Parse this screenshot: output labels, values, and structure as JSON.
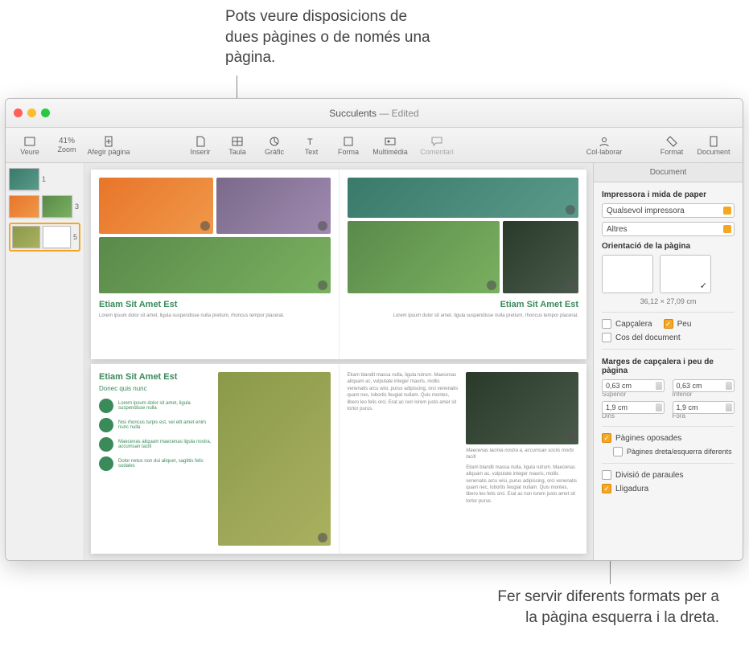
{
  "callouts": {
    "top": "Pots veure disposicions de dues pàgines o de només una pàgina.",
    "bottom": "Fer servir diferents formats per a la pàgina esquerra i la dreta."
  },
  "window": {
    "title_doc": "Succulents",
    "title_state": "Edited"
  },
  "toolbar": {
    "view": "Veure",
    "zoom_value": "41%",
    "zoom": "Zoom",
    "add_page": "Afegir pàgina",
    "insert": "Inserir",
    "table": "Taula",
    "chart": "Gràfic",
    "text": "Text",
    "shape": "Forma",
    "media": "Multimèdia",
    "comment": "Comentari",
    "collaborate": "Col·laborar",
    "format": "Format",
    "document": "Document"
  },
  "thumbs": {
    "nums": [
      "1",
      "3",
      "5"
    ]
  },
  "pages": {
    "heading": "Etiam Sit Amet Est",
    "subhead": "Donec quis nunc",
    "lorem_short": "Lorem ipsum dolor sit amet, ligula suspendisse nulla pretium, rhoncus tempor placerat.",
    "lorem_body": "Etiam blandit massa nulla, ligula rutrum. Maecenas aliquam ac, vulputate integer mauris, mollis venenatis arcu wisi, purus adipiscing, orci venenatis quam nec, lobortis feugiat nullam. Quis montes, libero leo felis orci. Erat ac non lorem justo amet sit tortor purus.",
    "bullet1": "Lorem ipsum dolor sit amet, ligula suspendisse nulla",
    "bullet2": "Nisi rhoncus turpis est, vel elit amet enim nunc nulla",
    "bullet3": "Maecenas aliquam maecenas ligula nostra, accumsan taciti",
    "bullet4": "Dolor netus non dui aliquet, sagittis felis sodales",
    "caption": "Maecenas lacinia nostra a, accumsan sociis morbi taciti"
  },
  "inspector": {
    "tab": "Document",
    "printer_header": "Impressora i mida de paper",
    "printer_value": "Qualsevol impressora",
    "paper_value": "Altres",
    "orientation_header": "Orientació de la pàgina",
    "dimensions": "36,12 × 27,09 cm",
    "header_chk": "Capçalera",
    "footer_chk": "Peu",
    "body_chk": "Cos del document",
    "margins_header": "Marges de capçalera i peu de pàgina",
    "m_top_val": "0,63 cm",
    "m_top_lbl": "Superior",
    "m_bot_val": "0,63 cm",
    "m_bot_lbl": "Inferior",
    "m_in_val": "1,9 cm",
    "m_in_lbl": "Dins",
    "m_out_val": "1,9 cm",
    "m_out_lbl": "Fora",
    "facing": "Pàgines oposades",
    "leftright": "Pàgines dreta/esquerra diferents",
    "hyphen": "Divisió de paraules",
    "ligature": "Lligadura"
  }
}
